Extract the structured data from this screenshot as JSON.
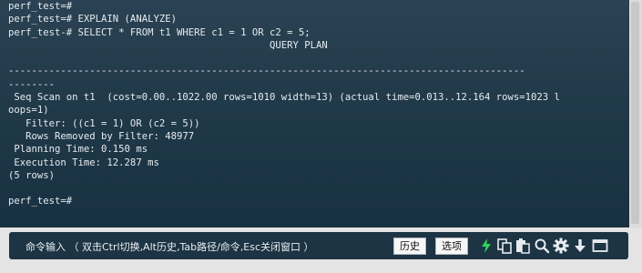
{
  "terminal": {
    "lines": [
      "perf_test=#",
      "perf_test=# EXPLAIN (ANALYZE)",
      "perf_test-# SELECT * FROM t1 WHERE c1 = 1 OR c2 = 5;",
      "                                             QUERY PLAN",
      "",
      "-----------------------------------------------------------------------------------------",
      "--------",
      " Seq Scan on t1  (cost=0.00..1022.00 rows=1010 width=13) (actual time=0.013..12.164 rows=1023 l",
      "oops=1)",
      "   Filter: ((c1 = 1) OR (c2 = 5))",
      "   Rows Removed by Filter: 48977",
      " Planning Time: 0.150 ms",
      " Execution Time: 12.287 ms",
      "(5 rows)",
      "",
      "perf_test=#"
    ]
  },
  "command_bar": {
    "hint": "命令输入 （ 双击Ctrl切换,Alt历史,Tab路径/命令,Esc关闭窗口 ）",
    "history_label": "历史",
    "options_label": "选项",
    "icons": [
      "lightning-icon",
      "copy-icon",
      "paste-icon",
      "search-icon",
      "gear-icon",
      "download-icon",
      "maximize-icon"
    ]
  },
  "colors": {
    "terminal_bg": "#1f3848",
    "terminal_text": "#e6ebef",
    "accent_green": "#2fd45a"
  }
}
